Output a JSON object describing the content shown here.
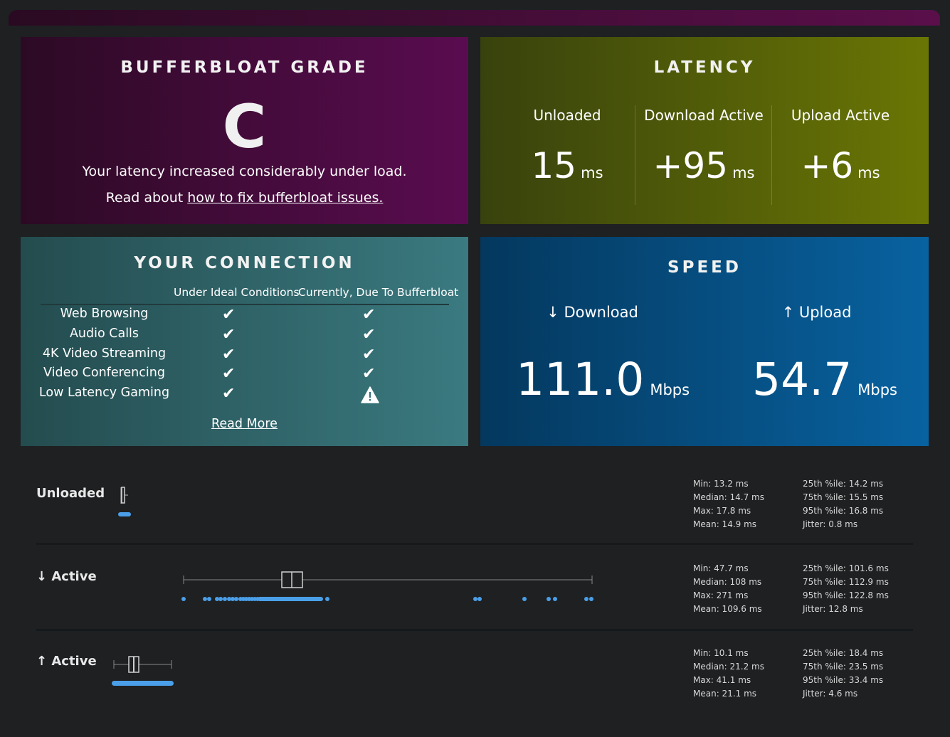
{
  "grade": {
    "title": "BUFFERBLOAT GRADE",
    "letter": "C",
    "message": "Your latency increased considerably under load.",
    "read_prefix": "Read about ",
    "read_link": "how to fix bufferbloat issues."
  },
  "latency": {
    "title": "LATENCY",
    "columns": [
      {
        "label": "Unloaded",
        "value": "15",
        "unit": "ms"
      },
      {
        "label": "Download Active",
        "value": "+95",
        "unit": "ms"
      },
      {
        "label": "Upload Active",
        "value": "+6",
        "unit": "ms"
      }
    ]
  },
  "connection": {
    "title": "YOUR CONNECTION",
    "headers": [
      "Under Ideal Conditions",
      "Currently, Due To Bufferbloat"
    ],
    "rows": [
      {
        "label": "Web Browsing",
        "ideal": "check",
        "current": "check"
      },
      {
        "label": "Audio Calls",
        "ideal": "check",
        "current": "check"
      },
      {
        "label": "4K Video Streaming",
        "ideal": "check",
        "current": "check"
      },
      {
        "label": "Video Conferencing",
        "ideal": "check",
        "current": "check"
      },
      {
        "label": "Low Latency Gaming",
        "ideal": "check",
        "current": "warning"
      }
    ],
    "read_more": "Read More"
  },
  "speed": {
    "title": "SPEED",
    "download_label": "↓ Download",
    "upload_label": "↑ Upload",
    "download_value": "111.0",
    "upload_value": "54.7",
    "unit": "Mbps"
  },
  "stats": [
    {
      "name": "Unloaded",
      "left": [
        "Min: 13.2 ms",
        "Median: 14.7 ms",
        "Max: 17.8 ms",
        "Mean: 14.9 ms"
      ],
      "right": [
        "25th %ile: 14.2 ms",
        "75th %ile: 15.5 ms",
        "95th %ile: 16.8 ms",
        "Jitter: 0.8 ms"
      ]
    },
    {
      "name": "↓ Active",
      "left": [
        "Min: 47.7 ms",
        "Median: 108 ms",
        "Max: 271 ms",
        "Mean: 109.6 ms"
      ],
      "right": [
        "25th %ile: 101.6 ms",
        "75th %ile: 112.9 ms",
        "95th %ile: 122.8 ms",
        "Jitter: 12.8 ms"
      ]
    },
    {
      "name": "↑ Active",
      "left": [
        "Min: 10.1 ms",
        "Median: 21.2 ms",
        "Max: 41.1 ms",
        "Mean: 21.1 ms"
      ],
      "right": [
        "25th %ile: 18.4 ms",
        "75th %ile: 23.5 ms",
        "95th %ile: 33.4 ms",
        "Jitter: 4.6 ms"
      ]
    }
  ],
  "colors": {
    "dot": "#4a9fe8",
    "box": "#cfcfcf"
  }
}
